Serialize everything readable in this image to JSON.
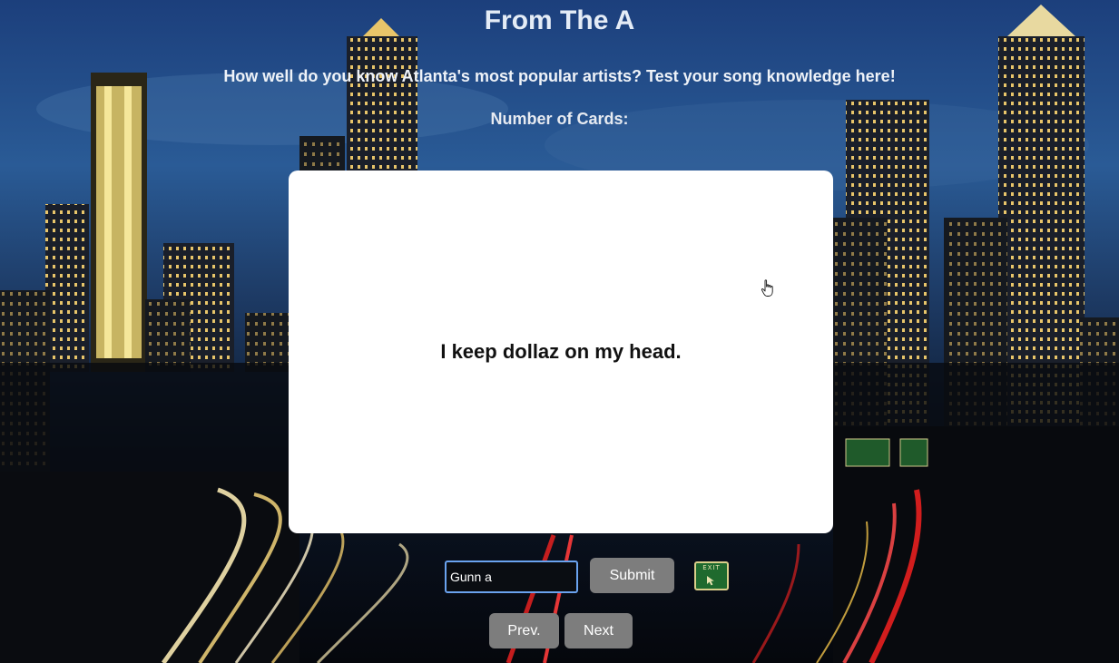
{
  "header": {
    "title": "From The A",
    "subtitle": "How well do you know Atlanta's most popular artists? Test your song knowledge here!",
    "card_count_label": "Number of Cards:"
  },
  "card": {
    "text": "I keep dollaz on my head."
  },
  "answer": {
    "value": "Gunn a"
  },
  "controls": {
    "submit_label": "Submit",
    "prev_label": "Prev.",
    "next_label": "Next"
  },
  "exit_sign": {
    "text": "EXIT"
  },
  "colors": {
    "button_bg": "#7d7d7d",
    "card_bg": "#ffffff",
    "input_border": "#6aa3ef",
    "sky_top": "#1c3f7c"
  },
  "icons": {
    "cursor": "hand-pointer-icon",
    "exit": "exit-sign-icon"
  }
}
